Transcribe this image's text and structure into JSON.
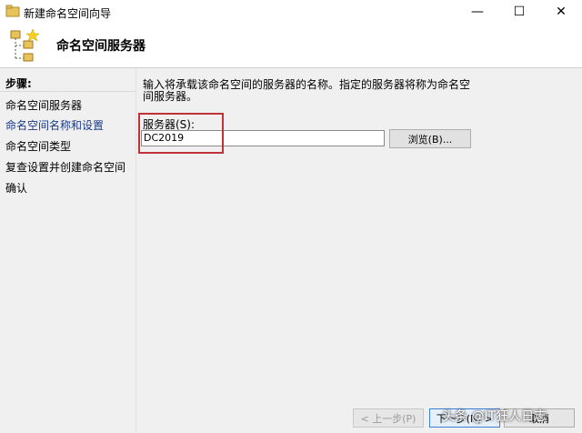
{
  "window": {
    "title": "新建命名空间向导",
    "minimize": "—",
    "maximize": "☐",
    "close": "✕"
  },
  "header": {
    "title": "命名空间服务器"
  },
  "sidebar": {
    "heading": "步骤:",
    "steps": [
      {
        "label": "命名空间服务器"
      },
      {
        "label": "命名空间名称和设置"
      },
      {
        "label": "命名空间类型"
      },
      {
        "label": "复查设置并创建命名空间"
      },
      {
        "label": "确认"
      }
    ]
  },
  "main": {
    "description": "输入将承载该命名空间的服务器的名称。指定的服务器将称为命名空间服务器。",
    "server_label": "服务器(S):",
    "server_value": "DC2019",
    "browse_label": "浏览(B)..."
  },
  "footer": {
    "prev_label": "< 上一步(P)",
    "next_label": "下一步(N) >",
    "cancel_label": "取消"
  },
  "watermark": "头条 @IT狂人日志",
  "colors": {
    "highlight": "#c0323a",
    "current_step": "#1a3a8a"
  }
}
